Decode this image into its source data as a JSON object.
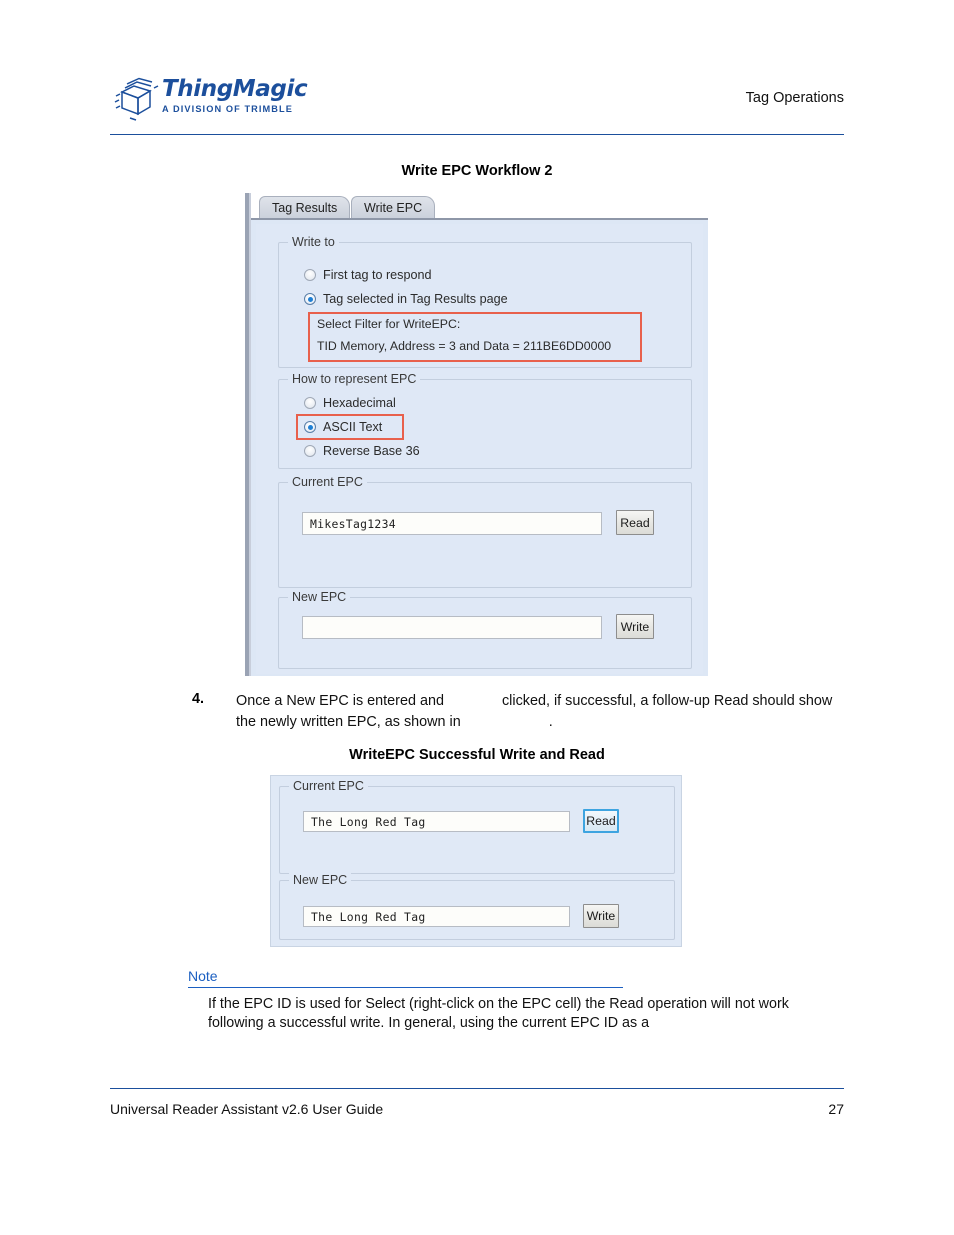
{
  "header": {
    "logo_name": "ThingMagic",
    "logo_tagline": "A DIVISION OF TRIMBLE",
    "section_title": "Tag Operations"
  },
  "figure1": {
    "caption": "Write EPC Workflow 2",
    "tabs": [
      {
        "label": "Tag Results",
        "active": false
      },
      {
        "label": "Write EPC",
        "active": true
      }
    ],
    "write_to": {
      "group_title": "Write to",
      "options": [
        {
          "label": "First tag to respond",
          "selected": false
        },
        {
          "label": "Tag selected in Tag Results page",
          "selected": true
        }
      ],
      "filter_label": "Select Filter for WriteEPC:",
      "filter_value": "TID Memory, Address = 3 and Data = 211BE6DD0000"
    },
    "represent": {
      "group_title": "How to represent EPC",
      "options": [
        {
          "label": "Hexadecimal",
          "selected": false
        },
        {
          "label": "ASCII Text",
          "selected": true
        },
        {
          "label": "Reverse Base 36",
          "selected": false
        }
      ]
    },
    "current_epc": {
      "group_title": "Current EPC",
      "value": "MikesTag1234",
      "placeholder": "",
      "button_label": "Read"
    },
    "new_epc": {
      "group_title": "New EPC",
      "value": "",
      "placeholder": "",
      "button_label": "Write"
    }
  },
  "step4": {
    "number": "4.",
    "text_part1": "Once a New EPC is entered and",
    "text_part2": "clicked, if successful, a follow-up Read should show the newly written EPC, as shown in",
    "text_part3": "."
  },
  "figure2": {
    "caption": "WriteEPC Successful Write and Read",
    "current_epc": {
      "group_title": "Current EPC",
      "value": "The Long Red Tag",
      "button_label": "Read"
    },
    "new_epc": {
      "group_title": "New EPC",
      "value": "The Long Red Tag",
      "button_label": "Write"
    }
  },
  "note": {
    "title": "Note",
    "body": "If the EPC ID is used for Select (right-click on the EPC cell) the Read operation will not work following a successful write. In general, using the current EPC ID as a"
  },
  "footer": {
    "document_title": "Universal Reader Assistant v2.6 User Guide",
    "page_number": "27"
  },
  "colors": {
    "brand_blue": "#1b4f9c",
    "note_blue": "#1b5fc1",
    "annotation_red": "#e8604c",
    "panel_blue": "#dfe8f6",
    "radio_dot": "#1f7fd4",
    "focus_border": "#3ea4e0"
  }
}
